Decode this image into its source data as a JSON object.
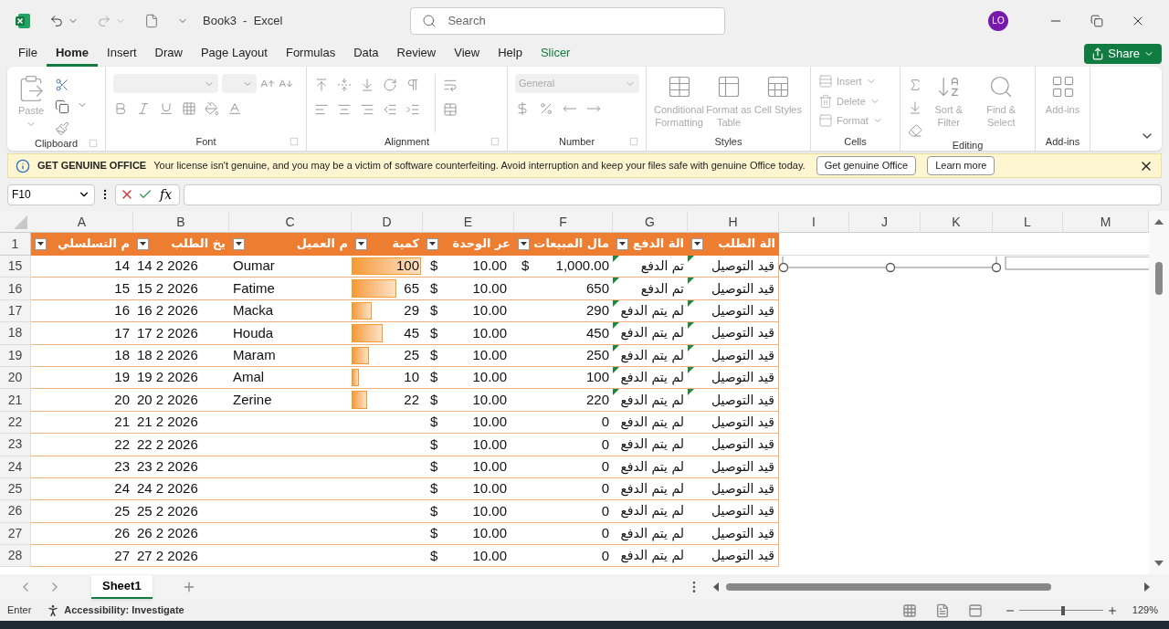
{
  "title_bar": {
    "title": "Book3  -  Excel",
    "search_placeholder": "Search",
    "avatar": "LO"
  },
  "menu_tabs": [
    {
      "label": "File",
      "selected": false,
      "kind": "standard"
    },
    {
      "label": "Home",
      "selected": true,
      "kind": "standard"
    },
    {
      "label": "Insert",
      "selected": false,
      "kind": "standard"
    },
    {
      "label": "Draw",
      "selected": false,
      "kind": "standard"
    },
    {
      "label": "Page Layout",
      "selected": false,
      "kind": "standard"
    },
    {
      "label": "Formulas",
      "selected": false,
      "kind": "standard"
    },
    {
      "label": "Data",
      "selected": false,
      "kind": "standard"
    },
    {
      "label": "Review",
      "selected": false,
      "kind": "standard"
    },
    {
      "label": "View",
      "selected": false,
      "kind": "standard"
    },
    {
      "label": "Help",
      "selected": false,
      "kind": "standard"
    },
    {
      "label": "Slicer",
      "selected": false,
      "kind": "contextual"
    }
  ],
  "share_button": "Share",
  "ribbon": {
    "paste": "Paste",
    "number_format": "General",
    "styles": [
      "Conditional Formatting",
      "Format as Table",
      "Cell Styles"
    ],
    "cells": [
      "Insert",
      "Delete",
      "Format"
    ],
    "editing": [
      "Sort & Filter",
      "Find & Select"
    ],
    "addins": "Add-ins",
    "groups": [
      "Clipboard",
      "Font",
      "Alignment",
      "Number",
      "Styles",
      "Cells",
      "Editing",
      "Add-ins"
    ]
  },
  "notice": {
    "title": "GET GENUINE OFFICE",
    "message": "Your license isn't genuine, and you may be a victim of software counterfeiting. Avoid interruption and keep your files safe with genuine Office today.",
    "buttons": [
      "Get genuine Office",
      "Learn more"
    ]
  },
  "formula_bar": {
    "name_box": "F10",
    "fx": "fx"
  },
  "sheet": {
    "columns": [
      "A",
      "B",
      "C",
      "D",
      "E",
      "F",
      "G",
      "H",
      "I",
      "J",
      "K",
      "L",
      "M"
    ],
    "header_row": "1",
    "table_headers": {
      "A": "م التسلسلي",
      "B": "يخ الطلب",
      "C": "م العميل",
      "D": "كمية",
      "E": "عر الوحدة",
      "F": "مال المبيعات",
      "G": "الة الدفع",
      "H": "الة الطلب"
    },
    "rows": [
      {
        "row": "15",
        "serial": "14",
        "date": "14 2 2026",
        "customer": "Oumar",
        "quantity": "100",
        "level": 1,
        "unit_currency": "$",
        "unit_price": "10.00",
        "total_currency": "$",
        "total": "1,000.00",
        "payment": "تم الدفع",
        "status": "قيد التوصيل",
        "flagged": true
      },
      {
        "row": "16",
        "serial": "15",
        "date": "15 2 2026",
        "customer": "Fatime",
        "quantity": "65",
        "level": 0.65,
        "unit_currency": "$",
        "unit_price": "10.00",
        "total": "650",
        "payment": "تم الدفع",
        "status": "قيد التوصيل",
        "flagged": true
      },
      {
        "row": "17",
        "serial": "16",
        "date": "16 2 2026",
        "customer": "Macka",
        "quantity": "29",
        "level": 0.29,
        "unit_currency": "$",
        "unit_price": "10.00",
        "total": "290",
        "payment": "لم يتم الدفع",
        "status": "قيد التوصيل",
        "flagged": true
      },
      {
        "row": "18",
        "serial": "17",
        "date": "17 2 2026",
        "customer": "Houda",
        "quantity": "45",
        "level": 0.45,
        "unit_currency": "$",
        "unit_price": "10.00",
        "total": "450",
        "payment": "لم يتم الدفع",
        "status": "قيد التوصيل",
        "flagged": true
      },
      {
        "row": "19",
        "serial": "18",
        "date": "18 2 2026",
        "customer": "Maram",
        "quantity": "25",
        "level": 0.25,
        "unit_currency": "$",
        "unit_price": "10.00",
        "total": "250",
        "payment": "لم يتم الدفع",
        "status": "قيد التوصيل",
        "flagged": true
      },
      {
        "row": "20",
        "serial": "19",
        "date": "19 2 2026",
        "customer": "Amal",
        "quantity": "10",
        "level": 0.1,
        "unit_currency": "$",
        "unit_price": "10.00",
        "total": "100",
        "payment": "لم يتم الدفع",
        "status": "قيد التوصيل",
        "flagged": true
      },
      {
        "row": "21",
        "serial": "20",
        "date": "20 2 2026",
        "customer": "Zerine",
        "quantity": "22",
        "level": 0.22,
        "unit_currency": "$",
        "unit_price": "10.00",
        "total": "220",
        "payment": "لم يتم الدفع",
        "status": "قيد التوصيل",
        "flagged": true
      },
      {
        "row": "22",
        "serial": "21",
        "date": "21 2 2026",
        "unit_currency": "$",
        "unit_price": "10.00",
        "total": "0",
        "payment": "لم يتم الدفع",
        "status": "قيد التوصيل",
        "flagged": false
      },
      {
        "row": "23",
        "serial": "22",
        "date": "22 2 2026",
        "unit_currency": "$",
        "unit_price": "10.00",
        "total": "0",
        "payment": "لم يتم الدفع",
        "status": "قيد التوصيل",
        "flagged": false
      },
      {
        "row": "24",
        "serial": "23",
        "date": "23 2 2026",
        "unit_currency": "$",
        "unit_price": "10.00",
        "total": "0",
        "payment": "لم يتم الدفع",
        "status": "قيد التوصيل",
        "flagged": false
      },
      {
        "row": "25",
        "serial": "24",
        "date": "24 2 2026",
        "unit_currency": "$",
        "unit_price": "10.00",
        "total": "0",
        "payment": "لم يتم الدفع",
        "status": "قيد التوصيل",
        "flagged": false
      },
      {
        "row": "26",
        "serial": "25",
        "date": "25 2 2026",
        "unit_currency": "$",
        "unit_price": "10.00",
        "total": "0",
        "payment": "لم يتم الدفع",
        "status": "قيد التوصيل",
        "flagged": false
      },
      {
        "row": "27",
        "serial": "26",
        "date": "26 2 2026",
        "unit_currency": "$",
        "unit_price": "10.00",
        "total": "0",
        "payment": "لم يتم الدفع",
        "status": "قيد التوصيل",
        "flagged": false
      },
      {
        "row": "28",
        "serial": "27",
        "date": "27 2 2026",
        "unit_currency": "$",
        "unit_price": "10.00",
        "total": "0",
        "payment": "لم يتم الدفع",
        "status": "قيد التوصيل",
        "flagged": false
      }
    ]
  },
  "sheet_tabs": [
    {
      "label": "Sheet1",
      "selected": true
    }
  ],
  "status_bar": {
    "mode": "Enter",
    "accessibility": "Accessibility: Investigate",
    "zoom": "129%",
    "zoom_slider": {
      "level": 0.52
    }
  }
}
